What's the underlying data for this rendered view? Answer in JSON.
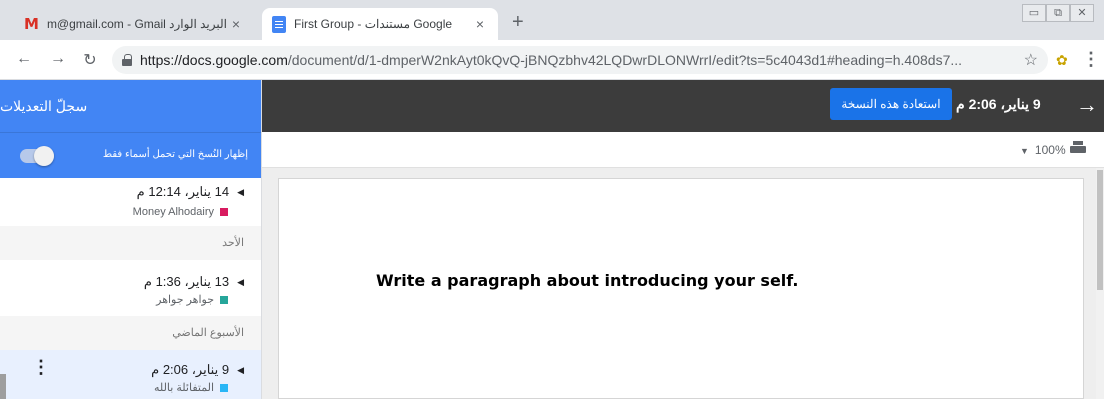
{
  "browser": {
    "tabs": [
      {
        "title": "m@gmail.com - Gmail البريد الوارد",
        "icon": "gmail-icon",
        "active": false
      },
      {
        "title": "First Group - مستندات Google",
        "icon": "docs-icon",
        "active": true
      }
    ],
    "new_tab": "+",
    "close": "×",
    "url_host": "https://docs.google.com",
    "url_path": "/document/d/1-dmperW2nkAyt0kQvQ-jBNQzbhv42LQDwrDLONWrrI/edit?ts=5c4043d1#heading=h.408ds7..."
  },
  "header": {
    "version_title": "9 يناير، 2:06 م",
    "restore_label": "استعادة هذه النسخة"
  },
  "toolbar": {
    "zoom": "100%"
  },
  "document": {
    "text": "Write a paragraph about introducing your self."
  },
  "sidebar": {
    "title": "سجلّ التعديلات",
    "toggle_label": "إظهار النُسخ التي تحمل أسماء فقط",
    "entries": [
      {
        "time": "14 يناير، 12:14 م",
        "author": "Money Alhodairy",
        "color": "#d81b60"
      },
      {
        "group": "الأحد"
      },
      {
        "time": "13 يناير، 1:36 م",
        "author": "جواهر جواهر",
        "color": "#26a69a"
      },
      {
        "group": "الأسبوع الماضي"
      },
      {
        "time": "9 يناير، 2:06 م",
        "author": "المتفائلة بالله",
        "color": "#29b6f6"
      }
    ]
  },
  "colors": {
    "accent": "#4285f4",
    "header_bg": "#3c3c3c",
    "button": "#1a73e8"
  }
}
